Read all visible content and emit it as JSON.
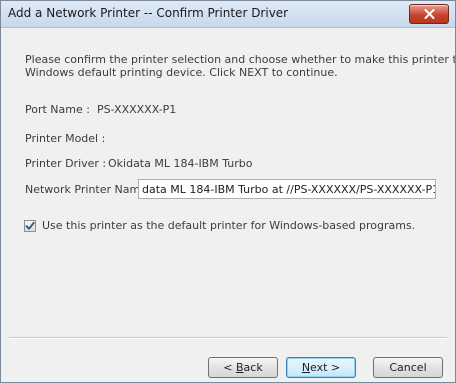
{
  "window": {
    "title": "Add a Network Printer -- Confirm Printer Driver",
    "close_icon": "close-icon"
  },
  "intro": {
    "line1": "Please confirm the printer selection and choose whether to make this printer the",
    "line2": "Windows default printing device. Click NEXT to continue."
  },
  "fields": {
    "port_name_label": "Port Name :",
    "port_name_value": "PS-XXXXXX-P1",
    "printer_model_label": "Printer Model :",
    "printer_driver_label": "Printer Driver :",
    "printer_driver_value": "Okidata ML 184-IBM Turbo",
    "network_printer_name_label": "Network Printer Name :",
    "network_printer_name_value": "data ML 184-IBM Turbo at //PS-XXXXXX/PS-XXXXXX-P1"
  },
  "default_printer": {
    "checked": true,
    "label": "Use this printer as the default printer for Windows-based programs."
  },
  "buttons": {
    "back_prefix": "< ",
    "back_accel": "B",
    "back_rest": "ack",
    "next_accel": "N",
    "next_rest": "ext >",
    "cancel": "Cancel"
  },
  "colors": {
    "title_bar": "#c7d8ec",
    "close_button": "#c7442f",
    "dialog_background": "#f0f0f0",
    "default_button_border": "#3c7fb1"
  }
}
